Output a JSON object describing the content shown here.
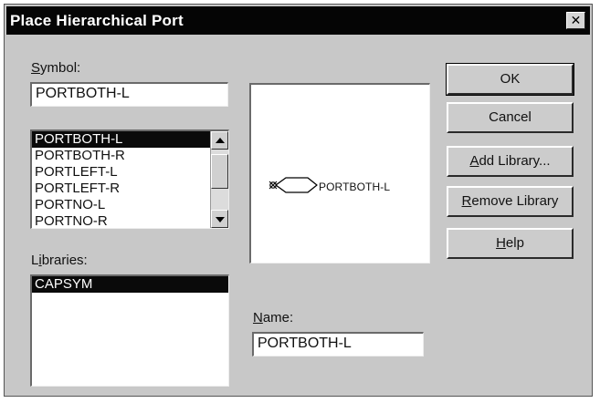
{
  "window": {
    "title": "Place Hierarchical Port",
    "close_glyph": "✕"
  },
  "symbol": {
    "label_accel": "S",
    "label_rest": "ymbol:",
    "value": "PORTBOTH-L",
    "list": [
      {
        "label": "PORTBOTH-L",
        "selected": true
      },
      {
        "label": "PORTBOTH-R",
        "selected": false
      },
      {
        "label": "PORTLEFT-L",
        "selected": false
      },
      {
        "label": "PORTLEFT-R",
        "selected": false
      },
      {
        "label": "PORTNO-L",
        "selected": false
      },
      {
        "label": "PORTNO-R",
        "selected": false
      }
    ]
  },
  "libraries": {
    "label_pre": "L",
    "label_accel": "i",
    "label_rest": "braries:",
    "list": [
      {
        "label": "CAPSYM",
        "selected": true
      }
    ]
  },
  "preview": {
    "port_label": "PORTBOTH-L"
  },
  "name": {
    "label_accel": "N",
    "label_rest": "ame:",
    "value": "PORTBOTH-L"
  },
  "buttons": {
    "ok": {
      "accel": "",
      "rest": "OK"
    },
    "cancel": {
      "accel": "",
      "rest": "Cancel"
    },
    "add_library": {
      "accel": "A",
      "rest": "dd Library..."
    },
    "remove_library": {
      "accel": "R",
      "rest": "emove Library"
    },
    "help": {
      "accel": "H",
      "rest": "elp"
    }
  },
  "colors": {
    "dialog_bg": "#c8c8c8",
    "titlebar_bg": "#050505",
    "selection_bg": "#0a0a0a"
  }
}
